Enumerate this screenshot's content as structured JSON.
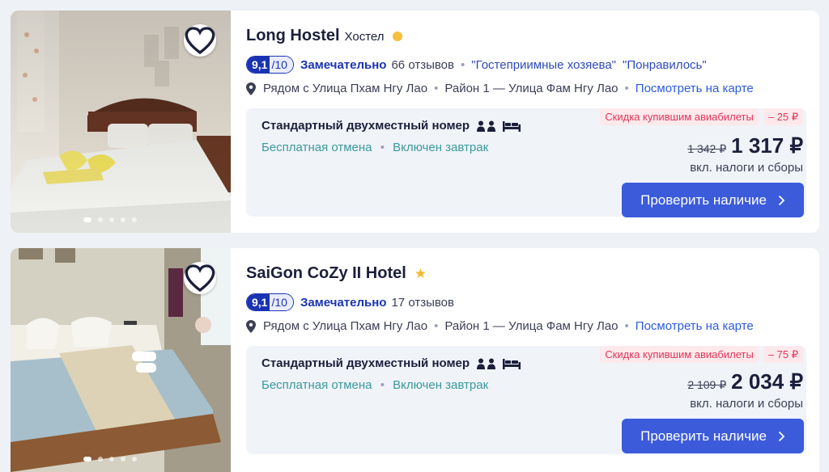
{
  "hotels": [
    {
      "name": "Long Hostel",
      "type": "Хостел",
      "score": "9,1",
      "score_max": "/10",
      "rating_word": "Замечательно",
      "reviews": "66 отзывов",
      "sep": "•",
      "quotes": [
        "\"Гостеприимные хозяева\"",
        "\"Понравилось\""
      ],
      "location_near": "Рядом с Улица Пхам Нгу Лао",
      "district": "Район 1 — Улица Фам Нгу Лао",
      "map_link": "Посмотреть на карте",
      "room_name": "Стандартный двухместный номер",
      "cancel": "Бесплатная отмена",
      "breakfast": "Включен завтрак",
      "promo_label": "Скидка купившим авиабилеты",
      "promo_amount": "– 25 ₽",
      "old_price": "1 342 ₽",
      "price": "1 317 ₽",
      "tax_note": "вкл. налоги и сборы",
      "button": "Проверить наличие"
    },
    {
      "name": "SaiGon CoZy II Hotel",
      "score": "9,1",
      "score_max": "/10",
      "rating_word": "Замечательно",
      "reviews": "17 отзывов",
      "sep": "•",
      "location_near": "Рядом с Улица Пхам Нгу Лао",
      "district": "Район 1 — Улица Фам Нгу Лао",
      "map_link": "Посмотреть на карте",
      "room_name": "Стандартный двухместный номер",
      "cancel": "Бесплатная отмена",
      "breakfast": "Включен завтрак",
      "promo_label": "Скидка купившим авиабилеты",
      "promo_amount": "– 75 ₽",
      "old_price": "2 109 ₽",
      "price": "2 034 ₽",
      "tax_note": "вкл. налоги и сборы",
      "button": "Проверить наличие"
    }
  ],
  "icons": {
    "favorite": "heart-icon",
    "location": "map-pin-icon",
    "guests": "person-icon",
    "bed": "bed-icon",
    "arrow": "chevron-right-icon",
    "hotel_star": "star-icon",
    "hostel_marker": "circle-icon"
  },
  "colors": {
    "accent_blue": "#3b5bdb",
    "rating_blue": "#1a33b3",
    "promo_red": "#e3365a",
    "feature_teal": "#3a9a9c",
    "star_yellow": "#f5b92e"
  },
  "carousel": {
    "count": 5,
    "active": 1
  }
}
